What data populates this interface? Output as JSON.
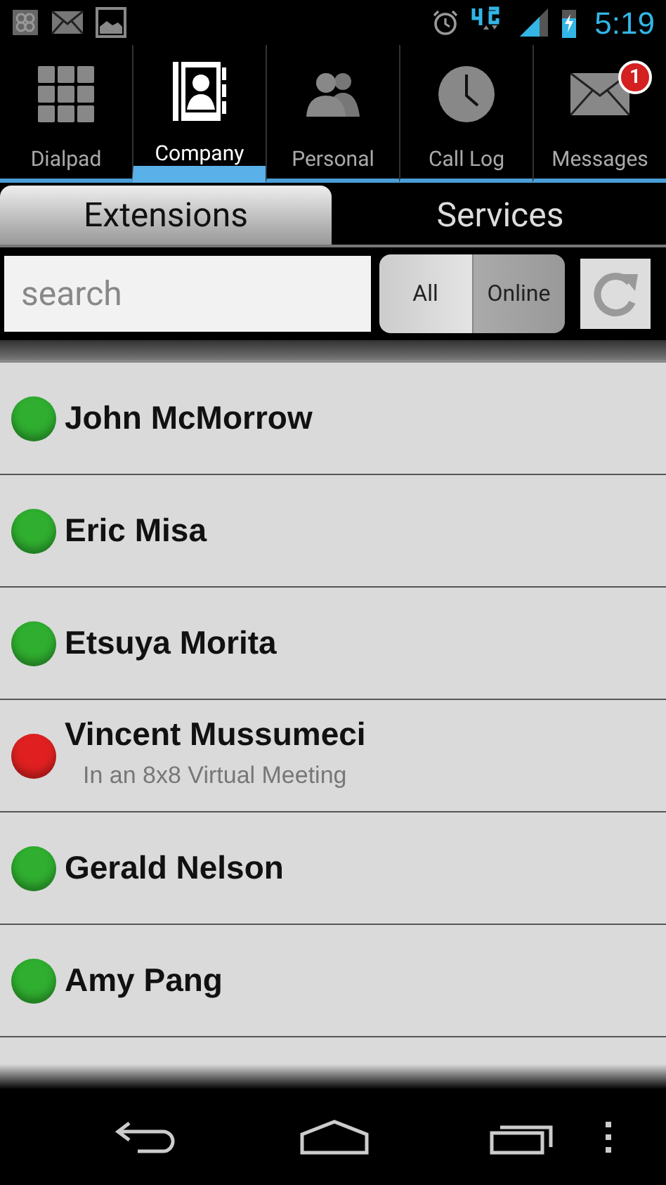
{
  "status_bar": {
    "time": "5:19"
  },
  "tabs": [
    {
      "label": "Dialpad",
      "kind": "grid",
      "selected": false
    },
    {
      "label": "Company",
      "kind": "contacts",
      "selected": true
    },
    {
      "label": "Personal",
      "kind": "people",
      "selected": false
    },
    {
      "label": "Call Log",
      "kind": "clock",
      "selected": false
    },
    {
      "label": "Messages",
      "kind": "mail",
      "selected": false,
      "badge": "1"
    }
  ],
  "sub_tabs": [
    {
      "label": "Extensions",
      "selected": true
    },
    {
      "label": "Services",
      "selected": false
    }
  ],
  "search": {
    "placeholder": "search"
  },
  "filter": [
    {
      "label": "All",
      "selected": false
    },
    {
      "label": "Online",
      "selected": true
    }
  ],
  "contacts": [
    {
      "name": "John McMorrow",
      "color": "#2fae2f"
    },
    {
      "name": "Eric Misa",
      "color": "#2fae2f"
    },
    {
      "name": "Etsuya Morita",
      "color": "#2fae2f"
    },
    {
      "name": "Vincent Mussumeci",
      "color": "#e02020",
      "note": "In an 8x8 Virtual Meeting"
    },
    {
      "name": "Gerald Nelson",
      "color": "#2fae2f"
    },
    {
      "name": "Amy Pang",
      "color": "#2fae2f"
    }
  ]
}
